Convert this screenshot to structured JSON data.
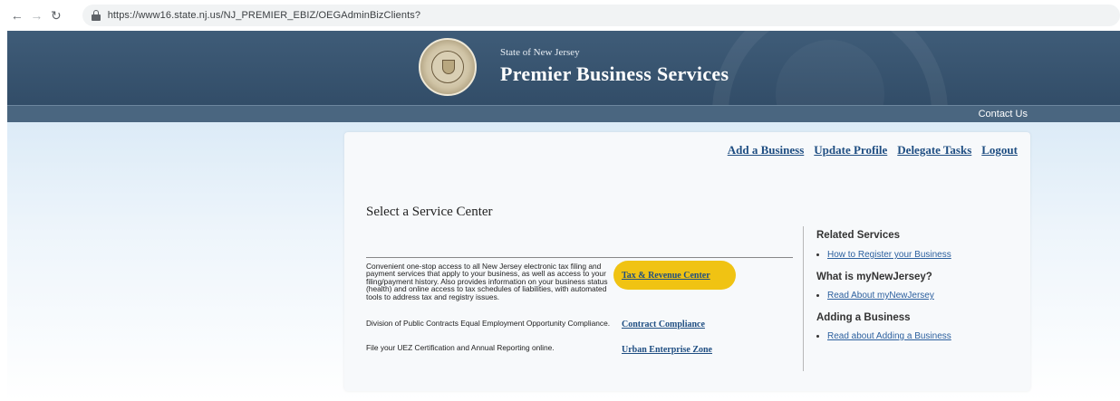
{
  "browser": {
    "url": "https://www16.state.nj.us/NJ_PREMIER_EBIZ/OEGAdminBizClients?"
  },
  "header": {
    "state_label": "State of New Jersey",
    "site_title": "Premier Business Services",
    "contact_label": "Contact Us"
  },
  "top_links": {
    "add_business": "Add a Business",
    "update_profile": "Update Profile",
    "delegate_tasks": "Delegate Tasks",
    "logout": "Logout"
  },
  "main": {
    "section_title": "Select a Service Center",
    "services": [
      {
        "description": "Convenient one-stop access to all New Jersey electronic tax filing and payment services that apply to your business, as well as access to your filing/payment history. Also provides information on your business status (health) and online access to tax schedules of liabilities, with automated tools to address tax and registry issues.",
        "link": "Tax & Revenue Center"
      },
      {
        "description": "Division of Public Contracts Equal Employment Opportunity Compliance.",
        "link": "Contract Compliance"
      },
      {
        "description": "File your UEZ Certification and Annual Reporting online.",
        "link": "Urban Enterprise Zone"
      }
    ]
  },
  "sidebar": {
    "related_heading": "Related Services",
    "related_link": "How to Register your Business",
    "what_heading": "What is myNewJersey?",
    "what_link": "Read About myNewJersey",
    "adding_heading": "Adding a Business",
    "adding_link": "Read about Adding a Business"
  },
  "colors": {
    "header_bg": "#3f5c78",
    "link_blue": "#1f4e82",
    "highlight_yellow": "#f0c313"
  }
}
